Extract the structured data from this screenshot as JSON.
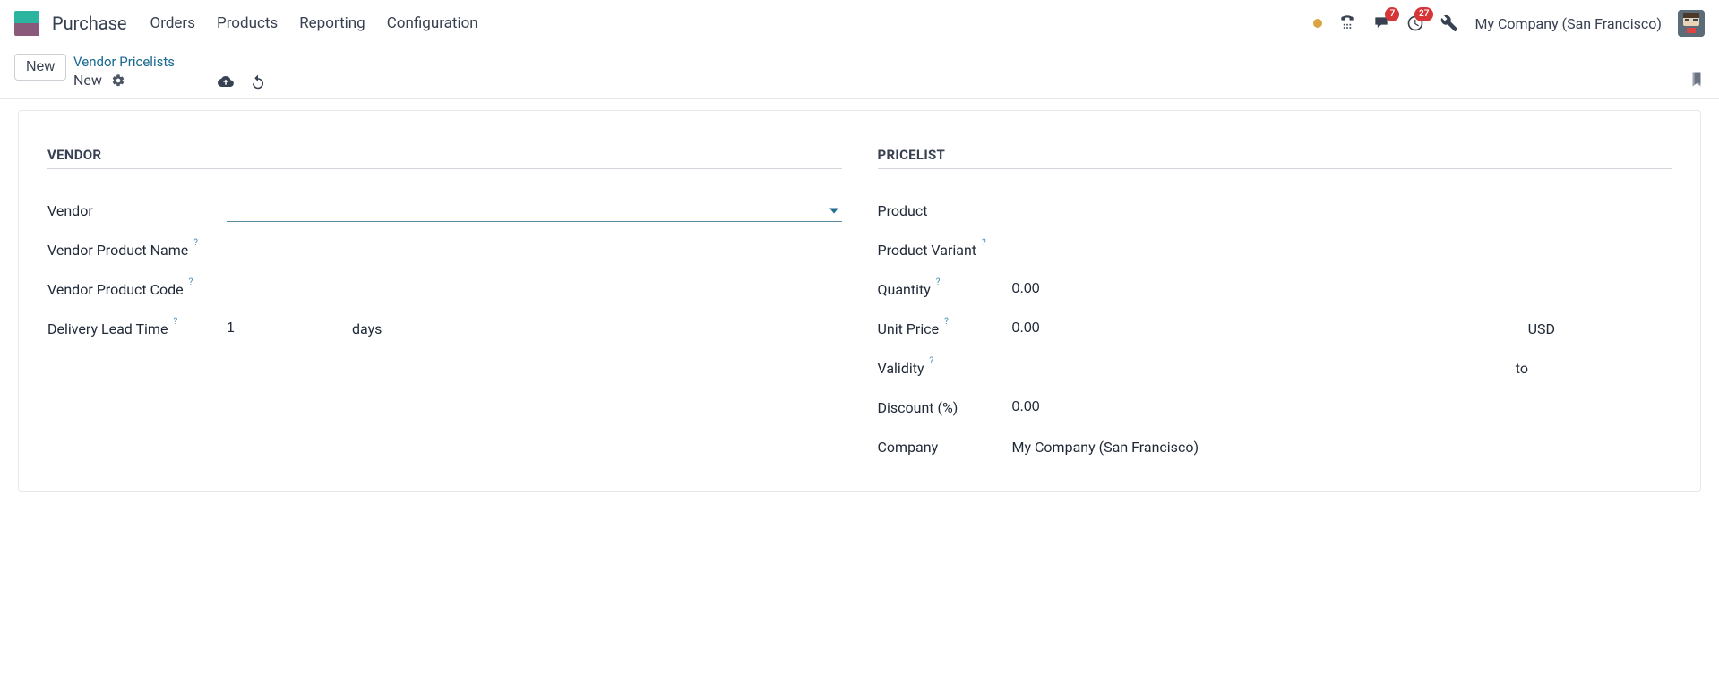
{
  "nav": {
    "app_title": "Purchase",
    "menu": [
      "Orders",
      "Products",
      "Reporting",
      "Configuration"
    ],
    "company": "My Company (San Francisco)",
    "badges": {
      "messages": "7",
      "activities": "27"
    }
  },
  "control": {
    "new_button": "New",
    "breadcrumb_parent": "Vendor Pricelists",
    "breadcrumb_current": "New"
  },
  "form": {
    "vendor_section": {
      "title": "VENDOR",
      "vendor_label": "Vendor",
      "vendor_value": "",
      "product_name_label": "Vendor Product Name",
      "product_code_label": "Vendor Product Code",
      "lead_time_label": "Delivery Lead Time",
      "lead_time_value": "1",
      "lead_time_unit": "days"
    },
    "pricelist_section": {
      "title": "PRICELIST",
      "product_label": "Product",
      "variant_label": "Product Variant",
      "quantity_label": "Quantity",
      "quantity_value": "0.00",
      "unit_price_label": "Unit Price",
      "unit_price_value": "0.00",
      "currency": "USD",
      "validity_label": "Validity",
      "validity_to": "to",
      "discount_label": "Discount (%)",
      "discount_value": "0.00",
      "company_label": "Company",
      "company_value": "My Company (San Francisco)"
    }
  }
}
